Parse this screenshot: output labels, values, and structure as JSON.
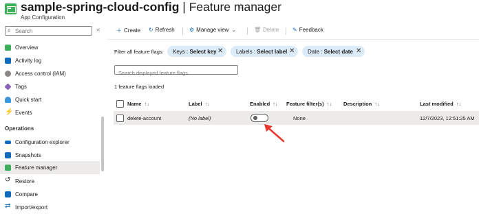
{
  "header": {
    "resource_name": "sample-spring-cloud-config",
    "separator": " | ",
    "page_name": "Feature manager",
    "subtitle": "App Configuration",
    "star_icon": "star-outline-icon",
    "more_icon": "more-icon"
  },
  "sidebar": {
    "search_placeholder": "Search",
    "collapse_glyph": "«",
    "items": [
      {
        "label": "Overview",
        "icon": "overview-icon",
        "color": "#3fae5b"
      },
      {
        "label": "Activity log",
        "icon": "activity-log-icon",
        "color": "#0f6cbd"
      },
      {
        "label": "Access control (IAM)",
        "icon": "people-icon",
        "color": "#605e5c"
      },
      {
        "label": "Tags",
        "icon": "tag-icon",
        "color": "#8764b8"
      },
      {
        "label": "Quick start",
        "icon": "cloud-icon",
        "color": "#3a96dd"
      },
      {
        "label": "Events",
        "icon": "lightning-icon",
        "color": "#f2c811"
      }
    ],
    "section_operations": "Operations",
    "operations_items": [
      {
        "label": "Configuration explorer",
        "icon": "config-explorer-icon",
        "color": "#0f6cbd",
        "active": false
      },
      {
        "label": "Snapshots",
        "icon": "snapshot-icon",
        "color": "#0f6cbd",
        "active": false
      },
      {
        "label": "Feature manager",
        "icon": "feature-manager-icon",
        "color": "#3fae5b",
        "active": true
      },
      {
        "label": "Restore",
        "icon": "restore-icon",
        "color": "#605e5c",
        "active": false
      },
      {
        "label": "Compare",
        "icon": "compare-icon",
        "color": "#0f6cbd",
        "active": false
      },
      {
        "label": "Import/export",
        "icon": "import-export-icon",
        "color": "#0f6cbd",
        "active": false
      }
    ]
  },
  "toolbar": {
    "create": "Create",
    "refresh": "Refresh",
    "manage_view": "Manage view",
    "delete": "Delete",
    "feedback": "Feedback"
  },
  "filters": {
    "label": "Filter all feature flags:",
    "pills": [
      {
        "key": "Keys : ",
        "value": "Select key"
      },
      {
        "key": "Labels : ",
        "value": "Select label"
      },
      {
        "key": "Date : ",
        "value": "Select date"
      }
    ]
  },
  "flag_search_placeholder": "Search displayed feature flags",
  "loaded_text": "1 feature flags loaded",
  "table": {
    "columns": [
      "Name",
      "Label",
      "Enabled",
      "Feature filter(s)",
      "Description",
      "Last modified"
    ],
    "sort_glyph": "↑↓",
    "rows": [
      {
        "name": "delete-account",
        "label": "(No label)",
        "enabled": false,
        "filters": "None",
        "description": "",
        "last_modified": "12/7/2023, 12:51:25 AM"
      }
    ]
  },
  "annotation": {
    "color": "#e8372c"
  }
}
